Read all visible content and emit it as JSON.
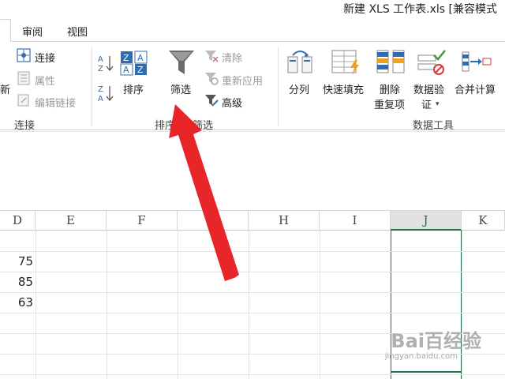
{
  "window": {
    "title": "新建 XLS 工作表.xls  [兼容模式"
  },
  "tabs": [
    {
      "label": "审阅"
    },
    {
      "label": "视图"
    }
  ],
  "ribbon": {
    "connections_group": {
      "new_partial": "新",
      "connect_label": "连接",
      "properties_label": "属性",
      "edit_links_label": "编辑链接",
      "group_label": "连接"
    },
    "sort_filter_group": {
      "sort_label": "排序",
      "filter_label": "筛选",
      "clear_label": "清除",
      "reapply_label": "重新应用",
      "advanced_label": "高级",
      "group_label_left": "排序",
      "group_label_right": "筛选"
    },
    "data_tools_group": {
      "split_label": "分列",
      "flash_fill_label": "快速填充",
      "remove_dup_line1": "删除",
      "remove_dup_line2": "重复项",
      "validation_line1": "数据验",
      "validation_line2": "证",
      "consolidate_label": "合并计算",
      "group_label": "数据工具"
    }
  },
  "sheet": {
    "columns": [
      "D",
      "E",
      "F",
      "G",
      "H",
      "I",
      "J",
      "K"
    ],
    "selected_column": "J",
    "cells": [
      {
        "col": "D",
        "value": "75"
      },
      {
        "col": "D",
        "value": "85"
      },
      {
        "col": "D",
        "value": "63"
      }
    ]
  },
  "watermark": {
    "main": "Bai百经验",
    "sub": "jingyan.baidu.com"
  },
  "colors": {
    "accent_green": "#217346",
    "annotation_red": "#e8262a",
    "sort_blue": "#2e6db4"
  }
}
